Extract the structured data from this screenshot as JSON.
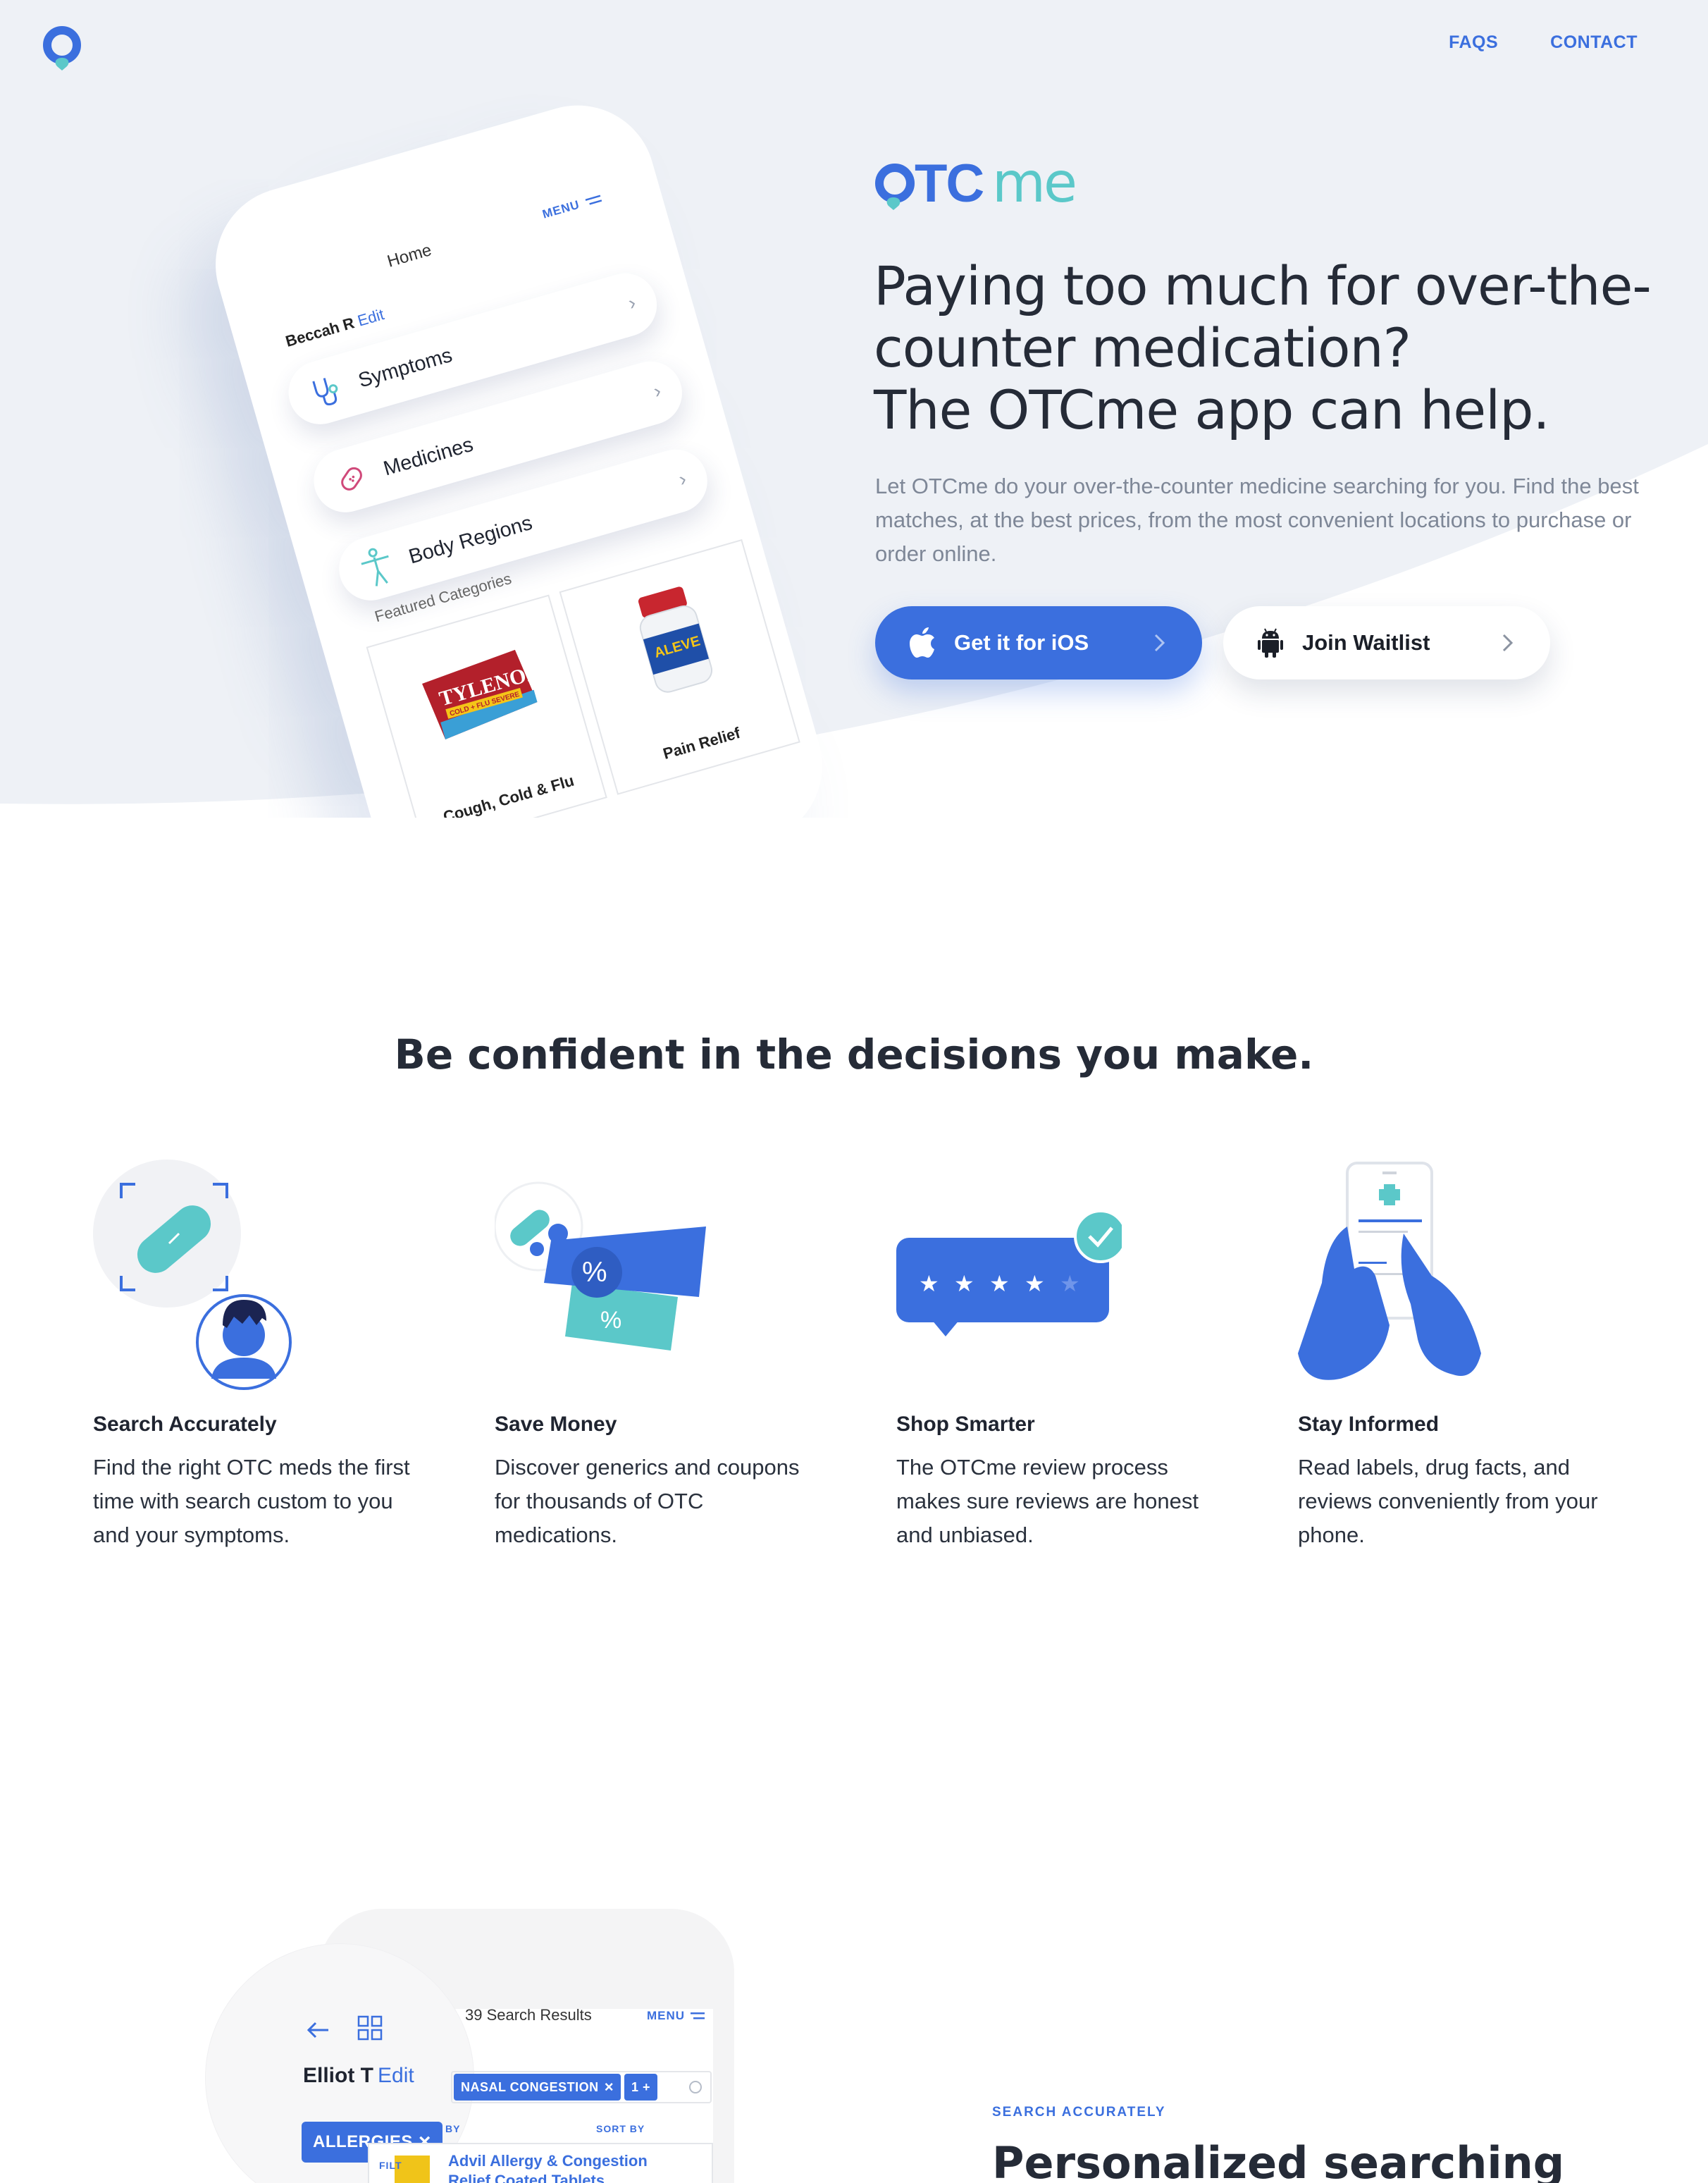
{
  "nav": {
    "links": [
      "FAQS",
      "CONTACT"
    ]
  },
  "hero": {
    "brand": "OTCme",
    "title_lines": [
      "Paying too much for over-the-",
      "counter medication?",
      "The OTCme app can help."
    ],
    "subtitle": "Let OTCme do your over-the-counter medicine searching for you. Find the best matches, at the best prices, from the most convenient locations to purchase or order online.",
    "ios_button": "Get it for iOS",
    "waitlist_button": "Join Waitlist"
  },
  "phone": {
    "home": "Home",
    "menu": "MENU",
    "user_name": "Beccah R",
    "user_edit": "Edit",
    "items": [
      "Symptoms",
      "Medicines",
      "Body Regions"
    ],
    "featured": "Featured Categories",
    "cards": [
      "Cough, Cold & Flu",
      "Pain Relief"
    ],
    "tylenol": "TYLENOL",
    "tylenol_sub": "COLD + FLU SEVERE",
    "aleve": "ALEVE"
  },
  "section2": {
    "title": "Be confident in the decisions you make.",
    "features": [
      {
        "title": "Search Accurately",
        "desc": "Find the right OTC meds the first time with search custom to you and your symptoms."
      },
      {
        "title": "Save Money",
        "desc": "Discover generics and coupons for thousands of OTC medications."
      },
      {
        "title": "Shop Smarter",
        "desc": "The OTCme review process makes sure reviews are honest and unbiased."
      },
      {
        "title": "Stay Informed",
        "desc": "Read labels, drug facts, and reviews conveniently from your phone."
      }
    ]
  },
  "section3": {
    "results": "39 Search Results",
    "menu": "MENU",
    "user_name": "Elliot T",
    "user_edit": "Edit",
    "chip_nasal": "NASAL CONGESTION",
    "chip_more": "1 +",
    "chip_allergies": "ALLERGIES",
    "filter_by": "BY",
    "sort_by": "SORT BY",
    "filter_label": "FILT",
    "product_title": "Advil Allergy & Congestion Relief Coated Tablets",
    "eyebrow": "SEARCH ACCURATELY",
    "heading": "Personalized searching"
  },
  "colors": {
    "accent": "#3b6fde",
    "teal": "#5bc8c9",
    "hero_bg": "#eef1f6",
    "text_dark": "#252b37",
    "text_muted": "#7e8797"
  },
  "icons": [
    "logo-pin-icon",
    "apple-icon",
    "android-icon",
    "chevron-right-icon",
    "stethoscope-icon",
    "bandage-icon",
    "body-icon",
    "hamburger-icon",
    "back-arrow-icon",
    "grid-icon",
    "close-icon"
  ]
}
